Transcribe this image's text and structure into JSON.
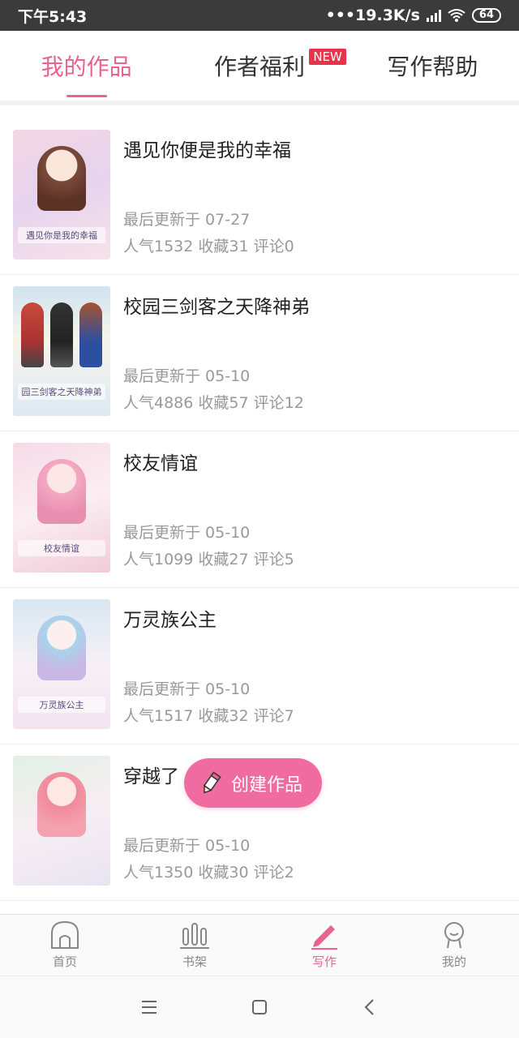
{
  "status": {
    "time": "下午5:43",
    "network_speed": "19.3K/s",
    "battery": "64"
  },
  "tabs": [
    {
      "label": "我的作品",
      "active": true
    },
    {
      "label": "作者福利",
      "badge": "NEW"
    },
    {
      "label": "写作帮助"
    }
  ],
  "works": [
    {
      "title": "遇见你便是我的幸福",
      "updated": "最后更新于 07-27",
      "stats": "人气1532  收藏31  评论0",
      "cover_text": "遇见你是我的幸福"
    },
    {
      "title": "校园三剑客之天降神弟",
      "updated": "最后更新于 05-10",
      "stats": "人气4886  收藏57  评论12",
      "cover_text": "园三剑客之天降神弟"
    },
    {
      "title": "校友情谊",
      "updated": "最后更新于 05-10",
      "stats": "人气1099  收藏27  评论5",
      "cover_text": "校友情谊"
    },
    {
      "title": "万灵族公主",
      "updated": "最后更新于 05-10",
      "stats": "人气1517  收藏32  评论7",
      "cover_text": "万灵族公主"
    },
    {
      "title": "穿越了",
      "updated": "最后更新于 05-10",
      "stats": "人气1350  收藏30  评论2",
      "cover_text": ""
    }
  ],
  "fab": {
    "label": "创建作品"
  },
  "bottom_nav": [
    {
      "label": "首页",
      "icon": "home-icon"
    },
    {
      "label": "书架",
      "icon": "bookshelf-icon"
    },
    {
      "label": "写作",
      "icon": "pencil-icon",
      "active": true
    },
    {
      "label": "我的",
      "icon": "profile-icon"
    }
  ],
  "colors": {
    "accent": "#e8638d",
    "fab": "#f06ba0",
    "badge": "#e8334a"
  }
}
